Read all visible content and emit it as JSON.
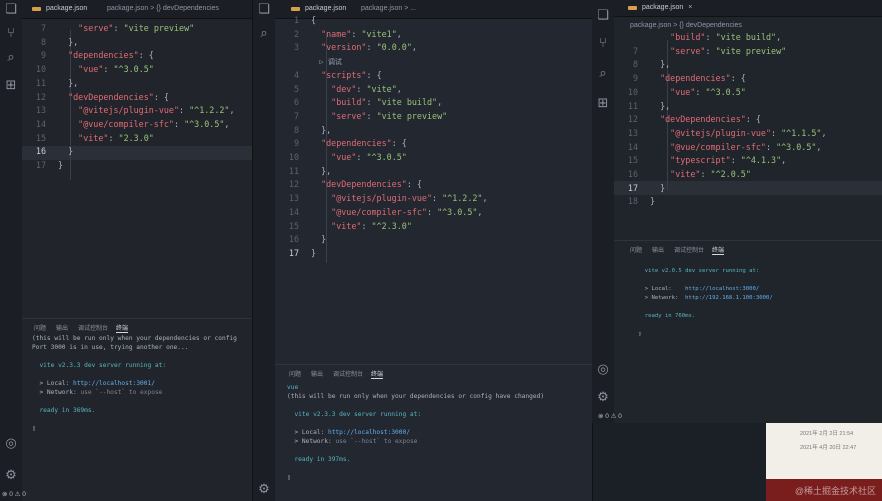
{
  "windows": [
    {
      "tab": "package.json",
      "breadcrumb": "package.json > {} devDependencies",
      "lines": [
        {
          "n": "7",
          "t": "    \"serve\": \"vite preview\""
        },
        {
          "n": "8",
          "t": "  },"
        },
        {
          "n": "9",
          "t": "  \"dependencies\": {"
        },
        {
          "n": "10",
          "t": "    \"vue\": \"^3.0.5\""
        },
        {
          "n": "11",
          "t": "  },"
        },
        {
          "n": "12",
          "t": "  \"devDependencies\": {"
        },
        {
          "n": "13",
          "t": "    \"@vitejs/plugin-vue\": \"^1.2.2\","
        },
        {
          "n": "14",
          "t": "    \"@vue/compiler-sfc\": \"^3.0.5\","
        },
        {
          "n": "15",
          "t": "    \"vite\": \"2.3.0\""
        },
        {
          "n": "16",
          "t": "  }"
        },
        {
          "n": "17",
          "t": "}"
        }
      ],
      "panel_tabs": [
        "问题",
        "输出",
        "调试控制台",
        "终端"
      ],
      "terminal": [
        "(this will be run only when your dependencies or config",
        "Port 3000 is in use, trying another one...",
        "",
        "  vite v2.3.3 dev server running at:",
        "",
        "  > Local: http://localhost:3001/",
        "  > Network: use `--host` to expose",
        "",
        "  ready in 369ms.",
        "",
        "▯"
      ],
      "status": "⊗ 0 ⚠ 0"
    },
    {
      "tab": "package.json",
      "breadcrumb": "package.json > ...",
      "lines": [
        {
          "n": "1",
          "t": "{"
        },
        {
          "n": "2",
          "t": "  \"name\": \"vite1\","
        },
        {
          "n": "3",
          "t": "  \"version\": \"0.0.0\","
        },
        {
          "n": "",
          "t": "  ▷ 调试"
        },
        {
          "n": "4",
          "t": "  \"scripts\": {"
        },
        {
          "n": "5",
          "t": "    \"dev\": \"vite\","
        },
        {
          "n": "6",
          "t": "    \"build\": \"vite build\","
        },
        {
          "n": "7",
          "t": "    \"serve\": \"vite preview\""
        },
        {
          "n": "8",
          "t": "  },"
        },
        {
          "n": "9",
          "t": "  \"dependencies\": {"
        },
        {
          "n": "10",
          "t": "    \"vue\": \"^3.0.5\""
        },
        {
          "n": "11",
          "t": "  },"
        },
        {
          "n": "12",
          "t": "  \"devDependencies\": {"
        },
        {
          "n": "13",
          "t": "    \"@vitejs/plugin-vue\": \"^1.2.2\","
        },
        {
          "n": "14",
          "t": "    \"@vue/compiler-sfc\": \"^3.0.5\","
        },
        {
          "n": "15",
          "t": "    \"vite\": \"^2.3.0\""
        },
        {
          "n": "16",
          "t": "  }"
        },
        {
          "n": "17",
          "t": "}"
        }
      ],
      "panel_tabs": [
        "问题",
        "输出",
        "调试控制台",
        "终端"
      ],
      "terminal": [
        "vue",
        "(this will be run only when your dependencies or config have changed)",
        "",
        "  vite v2.3.3 dev server running at:",
        "",
        "  > Local: http://localhost:3000/",
        "  > Network: use `--host` to expose",
        "",
        "  ready in 397ms.",
        "",
        "▯"
      ]
    },
    {
      "tab": "package.json",
      "breadcrumb": "package.json > {} devDependencies",
      "lines": [
        {
          "n": "",
          "t": "    \"build\": \"vite build\","
        },
        {
          "n": "7",
          "t": "    \"serve\": \"vite preview\""
        },
        {
          "n": "8",
          "t": "  },"
        },
        {
          "n": "9",
          "t": "  \"dependencies\": {"
        },
        {
          "n": "10",
          "t": "    \"vue\": \"^3.0.5\""
        },
        {
          "n": "11",
          "t": "  },"
        },
        {
          "n": "12",
          "t": "  \"devDependencies\": {"
        },
        {
          "n": "13",
          "t": "    \"@vitejs/plugin-vue\": \"^1.1.5\","
        },
        {
          "n": "14",
          "t": "    \"@vue/compiler-sfc\": \"^3.0.5\","
        },
        {
          "n": "15",
          "t": "    \"typescript\": \"^4.1.3\","
        },
        {
          "n": "16",
          "t": "    \"vite\": \"^2.0.5\""
        },
        {
          "n": "17",
          "t": "  }"
        },
        {
          "n": "18",
          "t": "}"
        }
      ],
      "panel_tabs": [
        "问题",
        "输出",
        "调试控制台",
        "终端"
      ],
      "terminal": [
        "  vite v2.0.5 dev server running at:",
        "",
        "  > Local:    http://localhost:3000/",
        "  > Network:  http://192.168.1.100:3000/",
        "",
        "  ready in 760ms.",
        "",
        "▯"
      ],
      "status": "⊗ 0 ⚠ 0"
    }
  ],
  "background_photo": {
    "lines": [
      "2021年 2月 2日 21:54",
      "2021年 4月 20日 22:47"
    ]
  },
  "watermark": "@稀土掘金技术社区"
}
